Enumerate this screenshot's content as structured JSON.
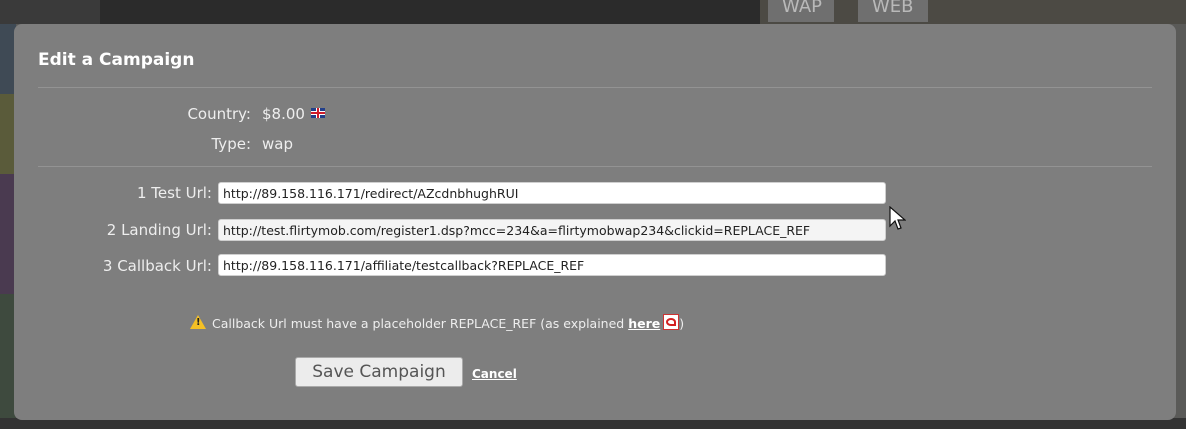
{
  "background": {
    "tabs": [
      "WAP",
      "WEB"
    ]
  },
  "modal": {
    "title": "Edit a Campaign",
    "country_label": "Country:",
    "country_value": "$8.00",
    "type_label": "Type:",
    "type_value": "wap",
    "fields": [
      {
        "label": "1 Test Url:",
        "value": "http://89.158.116.171/redirect/AZcdnbhughRUI"
      },
      {
        "label": "2 Landing Url:",
        "value": "http://test.flirtymob.com/register1.dsp?mcc=234&a=flirtymobwap234&clickid=REPLACE_REF"
      },
      {
        "label": "3 Callback Url:",
        "value": "http://89.158.116.171/affiliate/testcallback?REPLACE_REF"
      }
    ],
    "warning_text": "Callback Url must have a placeholder REPLACE_REF (as explained ",
    "warning_link": "here",
    "warning_close": ")",
    "save_label": "Save Campaign",
    "cancel_label": "Cancel"
  },
  "colors": {
    "modal_bg": "#7e7e7e",
    "warning": "#f4c025",
    "input_bg": "#ffffff"
  }
}
